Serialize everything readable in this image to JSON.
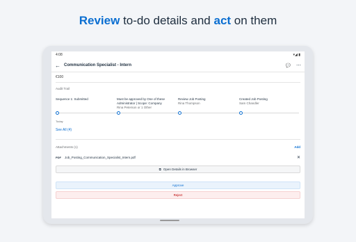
{
  "headline": {
    "word1": "Review",
    "middle": " to-do details and ",
    "word2": "act",
    "end": " on them"
  },
  "status_bar": {
    "time": "4:08",
    "icons": "▾◢ ▮"
  },
  "appbar": {
    "back_icon": "←",
    "title": "Communication Specialist - Intern",
    "chat_icon": "💬",
    "more_icon": "⋯"
  },
  "amount": "€100",
  "audit": {
    "label": "Audit Trail",
    "steps": [
      {
        "title": "Sequence 1: Submitted",
        "sub": ""
      },
      {
        "title": "Must be approved by One of these Administrator | Scope: Company",
        "sub": "Rina Peterson or 1 Other"
      },
      {
        "title": "Review Job Posting",
        "sub": "Rina Thompson"
      },
      {
        "title": "Created Job Posting",
        "sub": "Sam Chandler"
      }
    ],
    "today": "Today",
    "see_all": "See All (4)"
  },
  "attachments": {
    "label": "Attachments (1)",
    "add": "Add",
    "file_type": "PDF",
    "file_name": "Job_Posting_Communication_Specialist_Intern.pdf",
    "remove_icon": "✕"
  },
  "buttons": {
    "open_browser_icon": "⧉",
    "open_browser": "Open Details in Browser",
    "approve": "Approve",
    "reject": "Reject"
  },
  "colors": {
    "accent": "#0a6ed1",
    "reject": "#bb0000",
    "background": "#f3f5f8"
  }
}
